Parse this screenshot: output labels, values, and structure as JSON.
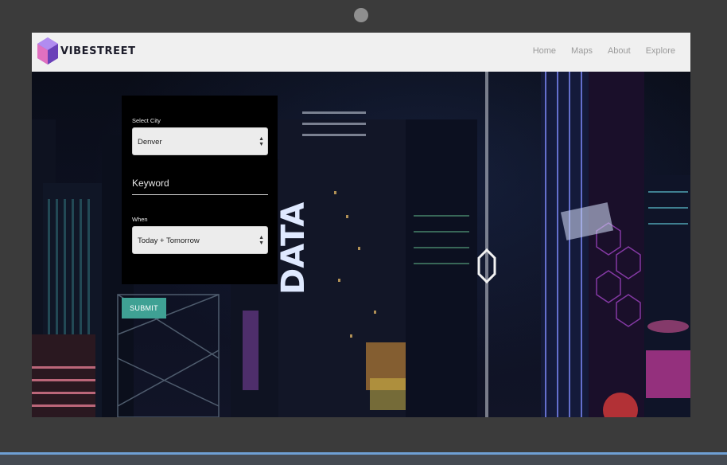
{
  "brand": {
    "name": "VIBESTREET"
  },
  "nav": {
    "items": [
      "Home",
      "Maps",
      "About",
      "Explore"
    ]
  },
  "form": {
    "city_label": "Select City",
    "city_value": "Denver",
    "keyword_placeholder": "Keyword",
    "when_label": "When",
    "when_value": "Today + Tomorrow",
    "submit_label": "SUBMIT"
  },
  "background": {
    "sign_text": "DATA"
  },
  "colors": {
    "accent": "#3fa194",
    "navbar": "#f0f0f0",
    "panel": "#000000",
    "frame": "#3b3b3b"
  },
  "icons": [
    "hexagon-logo-icon",
    "select-arrows-icon"
  ]
}
